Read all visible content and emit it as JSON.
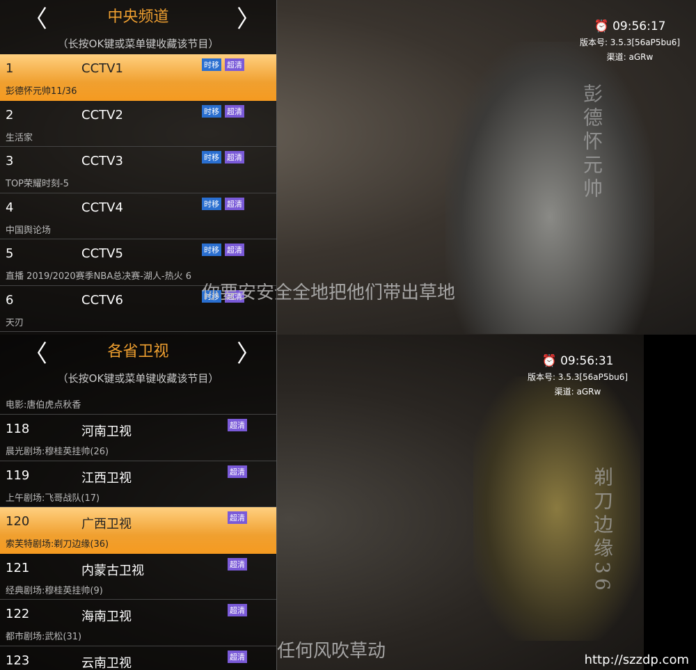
{
  "top": {
    "group_title": "中央频道",
    "hint": "（长按OK键或菜单键收藏该节目）",
    "channels": [
      {
        "num": "1",
        "name": "CCTV1",
        "program": "彭德怀元帅11/36",
        "timeshift": "时移",
        "hd": "超清"
      },
      {
        "num": "2",
        "name": "CCTV2",
        "program": "生活家",
        "timeshift": "时移",
        "hd": "超清"
      },
      {
        "num": "3",
        "name": "CCTV3",
        "program": "TOP荣耀时刻-5",
        "timeshift": "时移",
        "hd": "超清"
      },
      {
        "num": "4",
        "name": "CCTV4",
        "program": "中国舆论场",
        "timeshift": "时移",
        "hd": "超清"
      },
      {
        "num": "5",
        "name": "CCTV5",
        "program": "直播 2019/2020赛季NBA总决赛-湖人-热火 6",
        "timeshift": "时移",
        "hd": "超清"
      },
      {
        "num": "6",
        "name": "CCTV6",
        "program": "天刃",
        "timeshift": "时移",
        "hd": "超清"
      }
    ],
    "clock": "09:56:17",
    "version": "版本号: 3.5.3[56aP5bu6]",
    "channel": "渠道: aGRw",
    "subtitle": "你要安安全全地把他们带出草地",
    "show_title": "彭德怀元帅"
  },
  "bottom": {
    "group_title": "各省卫视",
    "hint": "（长按OK键或菜单键收藏该节目）",
    "partial_program": "电影:唐伯虎点秋香",
    "channels": [
      {
        "num": "118",
        "name": "河南卫视",
        "program": "晨光剧场:穆桂英挂帅(26)",
        "hd": "超清"
      },
      {
        "num": "119",
        "name": "江西卫视",
        "program": "上午剧场:飞哥战队(17)",
        "hd": "超清"
      },
      {
        "num": "120",
        "name": "广西卫视",
        "program": "索芙特剧场:剃刀边缘(36)",
        "hd": "超清"
      },
      {
        "num": "121",
        "name": "内蒙古卫视",
        "program": "经典剧场:穆桂英挂帅(9)",
        "hd": "超清"
      },
      {
        "num": "122",
        "name": "海南卫视",
        "program": "都市剧场:武松(31)",
        "hd": "超清"
      },
      {
        "num": "123",
        "name": "云南卫视",
        "program": "",
        "hd": "超清"
      }
    ],
    "clock": "09:56:31",
    "version": "版本号: 3.5.3[56aP5bu6]",
    "channel": "渠道: aGRw",
    "subtitle": "任何风吹草动",
    "show_title": "剃刀边缘36"
  },
  "arrows": {
    "left": "〈",
    "right": "〉"
  },
  "watermark": "http://szzdp.com"
}
